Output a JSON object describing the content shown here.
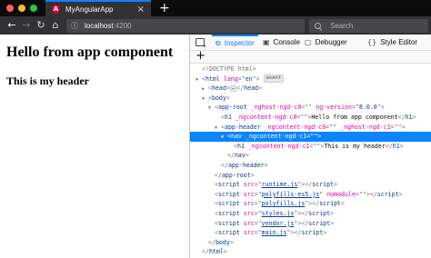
{
  "browser": {
    "tab_title": "MyAngularApp",
    "tab_favicon_letter": "A",
    "tab_close": "×",
    "new_tab": "+",
    "url_host": "localhost",
    "url_port": ":4200",
    "search_placeholder": "Search",
    "colors": {
      "accent": "#0a84ff",
      "angular_red": "#dd0031",
      "chrome_dark": "#0c0c0d"
    }
  },
  "page": {
    "heading1": "Hello from app component",
    "heading2": "This is my header"
  },
  "devtools": {
    "tabs": [
      {
        "label": "Inspector",
        "icon": "inspector-icon",
        "selected": true
      },
      {
        "label": "Console",
        "icon": "console-icon"
      },
      {
        "label": "Debugger",
        "icon": "debugger-icon"
      },
      {
        "label": "Style Editor",
        "icon": "style-editor-icon"
      }
    ],
    "add_node": "+",
    "tree": {
      "doctype": "<!DOCTYPE html>",
      "html_open": {
        "tag": "html",
        "attr": "lang",
        "value": "en",
        "badge": "event"
      },
      "head": {
        "tag": "head",
        "ellipsis": "…"
      },
      "body_open": "body",
      "app_root": {
        "tag": "app-root",
        "attr1": "_nghost-ngd-c0",
        "value1": "",
        "attr2": "ng-version",
        "value2": "8.0.0"
      },
      "h1": {
        "tag": "h1",
        "attr": "_ngcontent-ngd-c0",
        "value": "",
        "text": "Hello from app component"
      },
      "app_header": {
        "tag": "app-header",
        "attr1": "_ngcontent-ngd-c0",
        "value1": "",
        "attr2": "_nghost-ngd-c1",
        "value2": ""
      },
      "nav": {
        "tag": "nav",
        "attr": "_ngcontent-ngd-c1",
        "value": ""
      },
      "h1_inner": {
        "tag": "h1",
        "attr": "_ngcontent-ngd-c1",
        "value": "",
        "text": "This is my header"
      },
      "nav_close": "nav",
      "app_header_close": "app-header",
      "app_root_close": "app-root",
      "scripts": [
        {
          "src": "runtime.js",
          "extra": ""
        },
        {
          "src": "polyfills-es5.js",
          "extra": "nomodule"
        },
        {
          "src": "polyfills.js",
          "extra": ""
        },
        {
          "src": "styles.js",
          "extra": ""
        },
        {
          "src": "vendor.js",
          "extra": ""
        },
        {
          "src": "main.js",
          "extra": ""
        }
      ],
      "body_close": "body",
      "html_close": "html"
    }
  }
}
